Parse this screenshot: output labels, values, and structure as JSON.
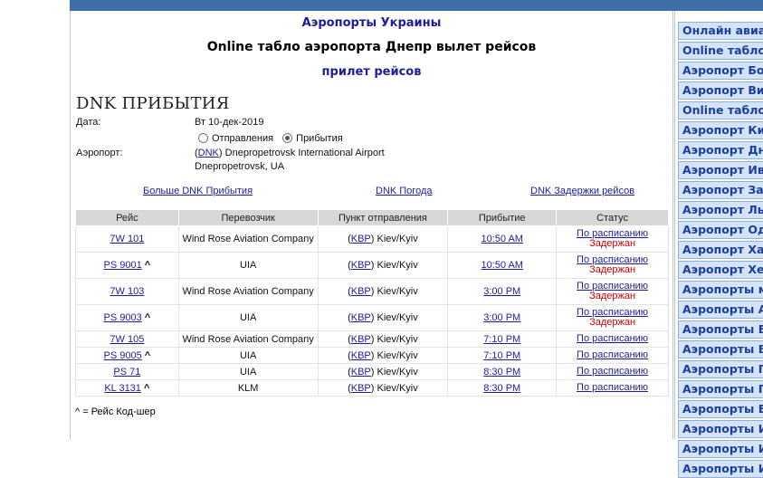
{
  "header": {
    "airports_link": "Аэропорты Украины",
    "title": "Online табло аэропорта Днепр вылет рейсов",
    "arrivals_link": "прилет рейсов"
  },
  "page_title": "DNK ПРИБЫТИЯ",
  "form": {
    "date_label": "Дата:",
    "date_value": "Вт 10-дек-2019",
    "radio_departures": "Отправления",
    "radio_arrivals": "Прибытия",
    "selected": "arrivals",
    "airport_label": "Аэропорт:",
    "airport_code": "DNK",
    "airport_name": "Dnepropetrovsk International Airport",
    "airport_city": "Dnepropetrovsk, UA"
  },
  "links": {
    "more": "Больше DNK Прибытия",
    "weather": "DNK Погода",
    "delays": "DNK Задержки рейсов"
  },
  "table": {
    "columns": [
      "Рейс",
      "Перевозчик",
      "Пункт отправления",
      "Прибытие",
      "Статус"
    ],
    "rows": [
      {
        "flight": "7W 101",
        "codeshare": false,
        "carrier": "Wind Rose Aviation Company",
        "code": "KBP",
        "city": "Kiev/Kyiv",
        "time": "10:50 AM",
        "status": "По расписанию",
        "late": "Задержан"
      },
      {
        "flight": "PS 9001",
        "codeshare": true,
        "carrier": "UIA",
        "code": "KBP",
        "city": "Kiev/Kyiv",
        "time": "10:50 AM",
        "status": "По расписанию",
        "late": "Задержан"
      },
      {
        "flight": "7W 103",
        "codeshare": false,
        "carrier": "Wind Rose Aviation Company",
        "code": "KBP",
        "city": "Kiev/Kyiv",
        "time": "3:00 PM",
        "status": "По расписанию",
        "late": "Задержан"
      },
      {
        "flight": "PS 9003",
        "codeshare": true,
        "carrier": "UIA",
        "code": "KBP",
        "city": "Kiev/Kyiv",
        "time": "3:00 PM",
        "status": "По расписанию",
        "late": "Задержан"
      },
      {
        "flight": "7W 105",
        "codeshare": false,
        "carrier": "Wind Rose Aviation Company",
        "code": "KBP",
        "city": "Kiev/Kyiv",
        "time": "7:10 PM",
        "status": "По расписанию",
        "late": ""
      },
      {
        "flight": "PS 9005",
        "codeshare": true,
        "carrier": "UIA",
        "code": "KBP",
        "city": "Kiev/Kyiv",
        "time": "7:10 PM",
        "status": "По расписанию",
        "late": ""
      },
      {
        "flight": "PS 71",
        "codeshare": false,
        "carrier": "UIA",
        "code": "KBP",
        "city": "Kiev/Kyiv",
        "time": "8:30 PM",
        "status": "По расписанию",
        "late": ""
      },
      {
        "flight": "KL 3131",
        "codeshare": true,
        "carrier": "KLM",
        "code": "KBP",
        "city": "Kiev/Kyiv",
        "time": "8:30 PM",
        "status": "По расписанию",
        "late": ""
      }
    ],
    "codeshare_mark": "^"
  },
  "footnote": "^ = Рейс Код-шер",
  "sidebar": {
    "items": [
      "Онлайн авиа",
      "Online табло",
      "Аэропорт Бор",
      "Аэропорт Вин",
      "Online табло",
      "Аэропорт Кие",
      "Аэропорт Дне",
      "Аэропорт Ива",
      "Аэропорт Зап",
      "Аэропорт Льв",
      "Аэропорт Оде",
      "Аэропорт Хар",
      "Аэропорт Хер",
      "Аэропорты м",
      "Аэропорты А",
      "Аэропорты Б",
      "Аэропорты В",
      "Аэропорты Г",
      "Аэропорты Ге",
      "Аэропорты Е",
      "Аэропорты И",
      "Аэропорты И",
      "Аэропорты И"
    ]
  },
  "colors": {
    "topbar": "#3e6ea8",
    "link": "#1d1d9a",
    "delayed": "#cc0000",
    "sidebar_bg": "#d4e3f6"
  }
}
